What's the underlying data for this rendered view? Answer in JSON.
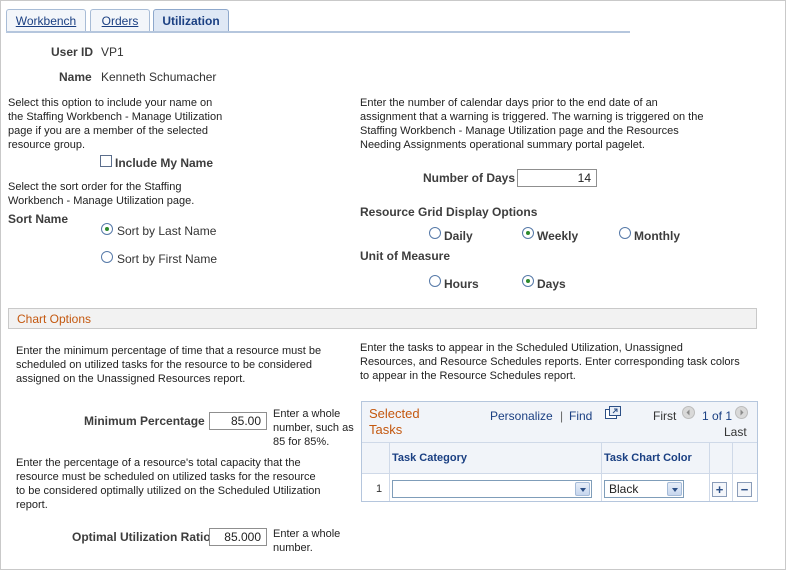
{
  "tabs": [
    {
      "label": "Workbench",
      "active": false
    },
    {
      "label": "Orders",
      "active": false
    },
    {
      "label": "Utilization",
      "active": true
    }
  ],
  "user": {
    "user_id_label": "User ID",
    "user_id": "VP1",
    "name_label": "Name",
    "name": "Kenneth Schumacher"
  },
  "left": {
    "include_help": "Select this option to include your name on the Staffing Workbench - Manage Utilization page if you are a member of the selected resource group.",
    "include_my_name_label": "Include My Name",
    "include_my_name_checked": false,
    "sort_help": "Select the sort order for the Staffing Workbench - Manage Utilization page.",
    "sort_name_label": "Sort Name",
    "sort_options": [
      {
        "label": "Sort by Last Name",
        "selected": true
      },
      {
        "label": "Sort by First Name",
        "selected": false
      }
    ]
  },
  "right": {
    "days_help": "Enter the number of calendar days prior to the end date of an assignment that a warning is triggered. The warning is triggered on the Staffing Workbench - Manage Utilization page and the Resources Needing Assignments operational summary portal pagelet.",
    "number_of_days_label": "Number of Days",
    "number_of_days": "14",
    "grid_display_label": "Resource Grid Display Options",
    "grid_display_options": [
      {
        "label": "Daily",
        "selected": false
      },
      {
        "label": "Weekly",
        "selected": true
      },
      {
        "label": "Monthly",
        "selected": false
      }
    ],
    "uom_label": "Unit of Measure",
    "uom_options": [
      {
        "label": "Hours",
        "selected": false
      },
      {
        "label": "Days",
        "selected": true
      }
    ]
  },
  "chart_options": {
    "section_title": "Chart Options",
    "min_pct_help": "Enter the minimum percentage of time that a resource must be scheduled on utilized tasks for the resource to be considered assigned on the Unassigned Resources report.",
    "min_pct_label": "Minimum Percentage",
    "min_pct_value": "85.00",
    "min_pct_hint": "Enter a whole number, such as 85 for 85%.",
    "opt_help": "Enter the percentage of a resource's total capacity that the resource must be scheduled on utilized tasks for the resource to be considered optimally utilized on the Scheduled Utilization report.",
    "opt_label": "Optimal Utilization Ratio",
    "opt_value": "85.000",
    "opt_hint": "Enter a whole number.",
    "tasks_help": "Enter the tasks to appear in the Scheduled Utilization, Unassigned Resources, and Resource Schedules reports. Enter corresponding task colors to appear in the Resource Schedules report."
  },
  "tasks_grid": {
    "title": "Selected Tasks",
    "personalize": "Personalize",
    "separator": "|",
    "find": "Find",
    "first": "First",
    "range": "1 of 1",
    "last": "Last",
    "col_category": "Task Category",
    "col_color": "Task Chart Color",
    "rows": [
      {
        "num": "1",
        "category": "",
        "color": "Black"
      }
    ],
    "icons": [
      "view-all-icon",
      "prev-icon",
      "next-icon",
      "add-row-icon",
      "delete-row-icon"
    ]
  },
  "colors": {
    "accent_orange": "#c4580f",
    "link_blue": "#1a3f82",
    "radio_green": "#2d8a2d"
  }
}
